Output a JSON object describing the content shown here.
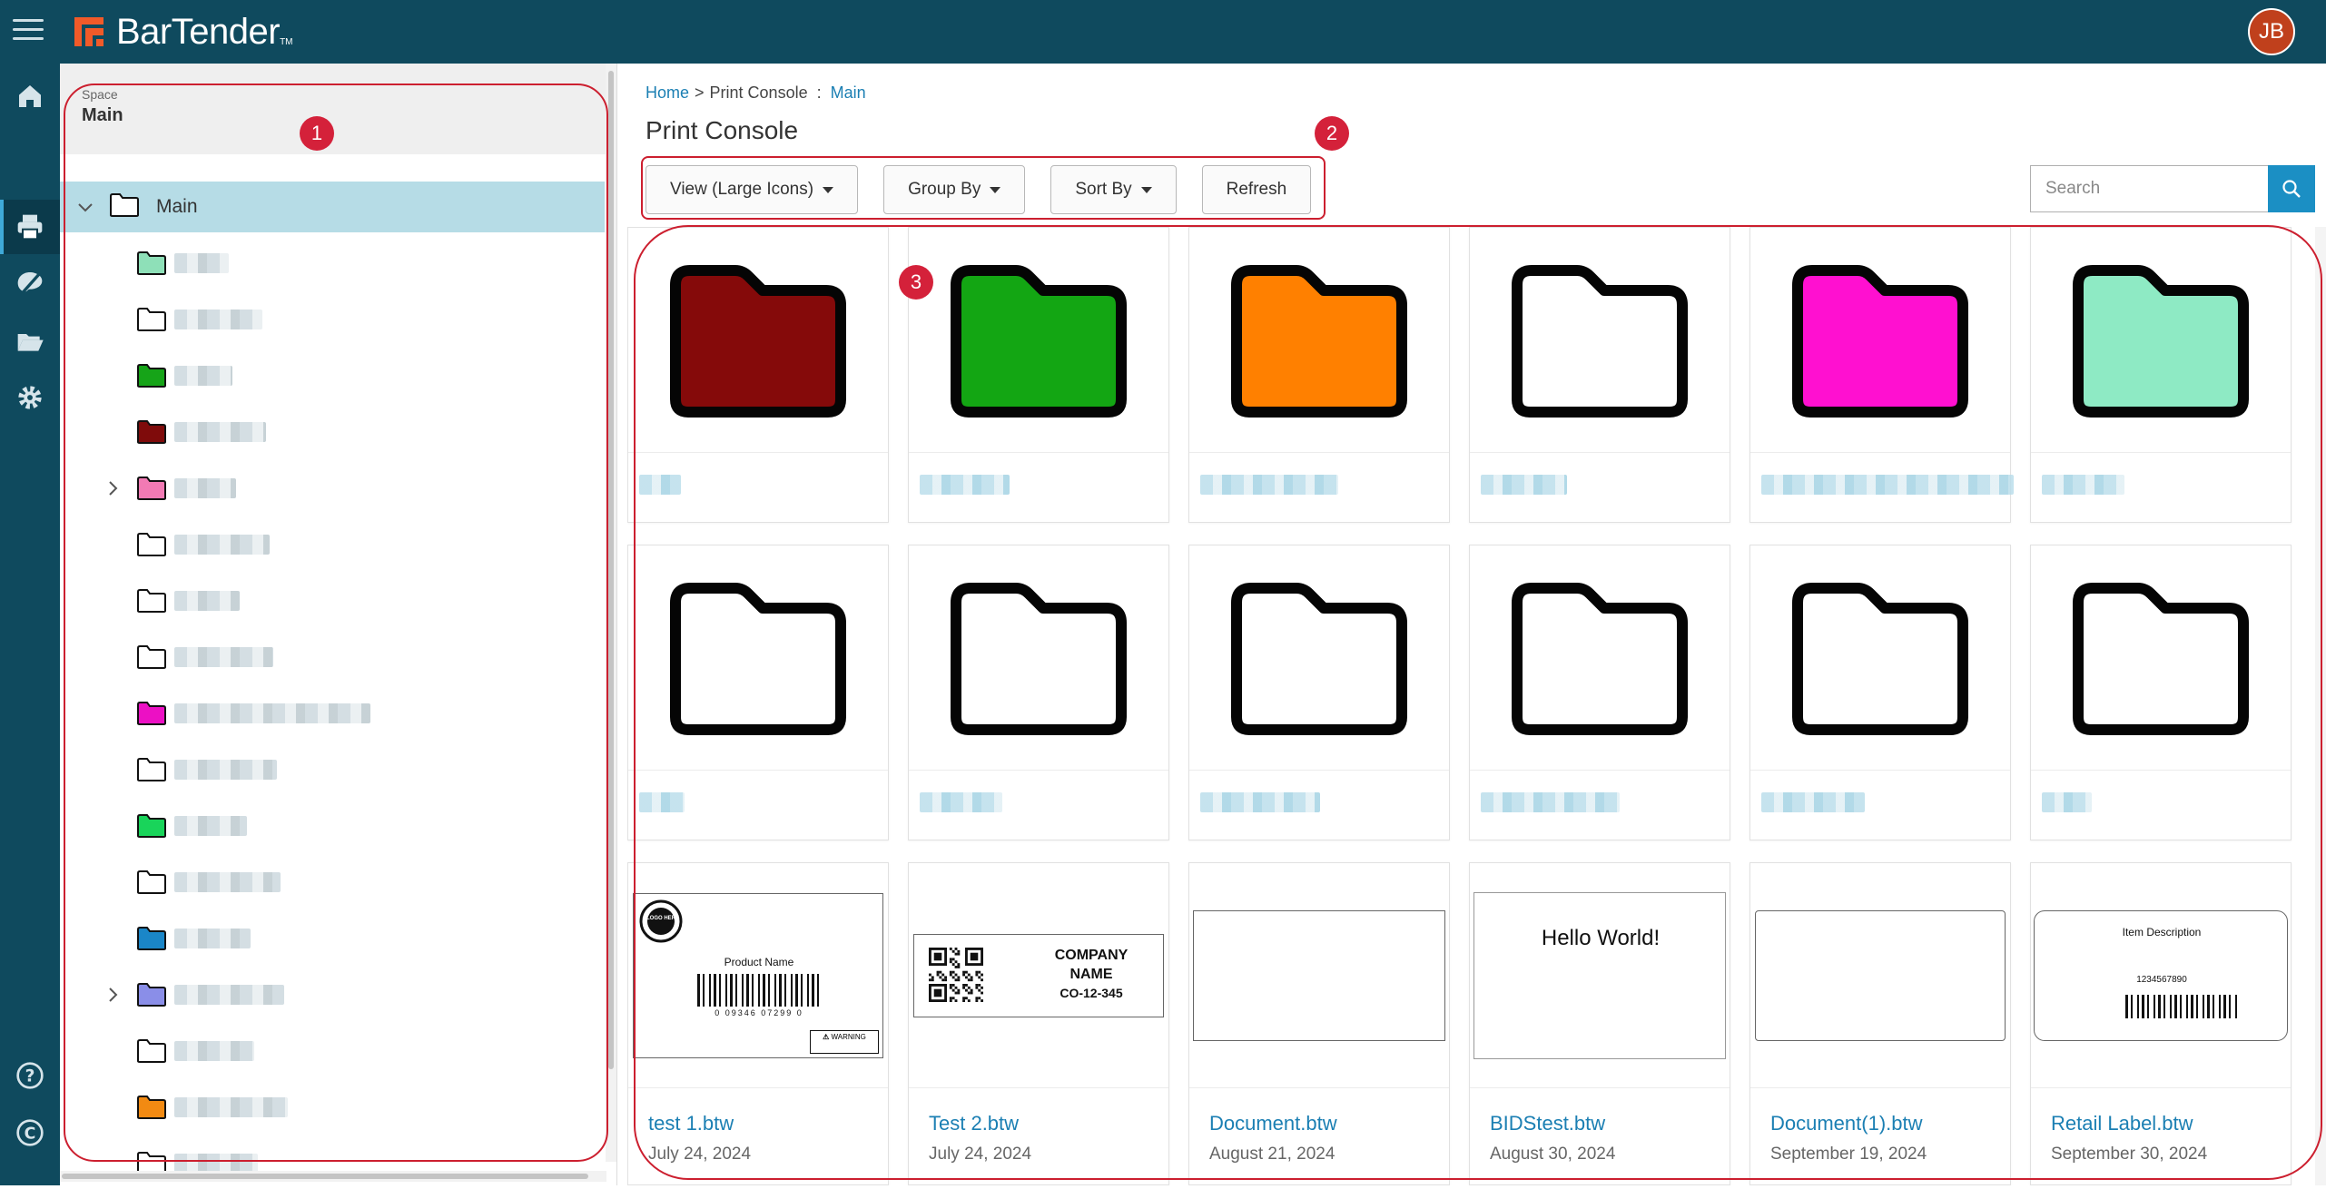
{
  "app": {
    "brand": "BarTender",
    "user_initials": "JB"
  },
  "rail": [
    "home-icon",
    "printer-icon",
    "design-icon",
    "folder-open-icon",
    "gear-icon",
    "help-icon",
    "copyright-icon"
  ],
  "tree": {
    "space_caption": "Space",
    "space_name": "Main",
    "root_label": "Main",
    "children": [
      {
        "color": "#8ee0b8",
        "expandable": false
      },
      {
        "color": "#ffffff",
        "expandable": false
      },
      {
        "color": "#16a418",
        "expandable": false
      },
      {
        "color": "#7f0b0b",
        "expandable": false
      },
      {
        "color": "#f27ab4",
        "expandable": true
      },
      {
        "color": "#ffffff",
        "expandable": false
      },
      {
        "color": "#ffffff",
        "expandable": false
      },
      {
        "color": "#ffffff",
        "expandable": false
      },
      {
        "color": "#ec10c4",
        "expandable": false
      },
      {
        "color": "#ffffff",
        "expandable": false
      },
      {
        "color": "#19d45a",
        "expandable": false
      },
      {
        "color": "#ffffff",
        "expandable": false
      },
      {
        "color": "#1a86c8",
        "expandable": false
      },
      {
        "color": "#8a8ee8",
        "expandable": true
      },
      {
        "color": "#ffffff",
        "expandable": false
      },
      {
        "color": "#f28a12",
        "expandable": false
      },
      {
        "color": "#ffffff",
        "expandable": false
      }
    ]
  },
  "breadcrumb": {
    "home": "Home",
    "sep1": ">",
    "current": "Print Console",
    "sep2": ":",
    "space": "Main"
  },
  "page_title": "Print Console",
  "toolbar": {
    "view_label": "View (Large Icons)",
    "group_label": "Group By",
    "sort_label": "Sort By",
    "refresh_label": "Refresh"
  },
  "search": {
    "placeholder": "Search"
  },
  "folders_row1": [
    "#850a0a",
    "#13a613",
    "#ff8000",
    "#ffffff",
    "#ff10d0",
    "#8eeac4"
  ],
  "folders_row2": [
    "#ffffff",
    "#ffffff",
    "#ffffff",
    "#ffffff",
    "#ffffff",
    "#ffffff"
  ],
  "documents": [
    {
      "name": "test 1.btw",
      "date": "July 24, 2024",
      "product_name": "Product Name",
      "barcode_digits": "0 09346 07299 0",
      "logo_text": "LOGO HERE",
      "warning": "WARNING"
    },
    {
      "name": "Test 2.btw",
      "date": "July 24, 2024",
      "line1": "COMPANY",
      "line2": "NAME",
      "line3": "CO-12-345"
    },
    {
      "name": "Document.btw",
      "date": "August 21, 2024"
    },
    {
      "name": "BIDStest.btw",
      "date": "August 30, 2024",
      "text": "Hello World!"
    },
    {
      "name": "Document(1).btw",
      "date": "September 19, 2024"
    },
    {
      "name": "Retail Label.btw",
      "date": "September 30, 2024",
      "desc": "Item Description",
      "code": "1234567890"
    }
  ],
  "callouts": [
    "1",
    "2",
    "3"
  ]
}
